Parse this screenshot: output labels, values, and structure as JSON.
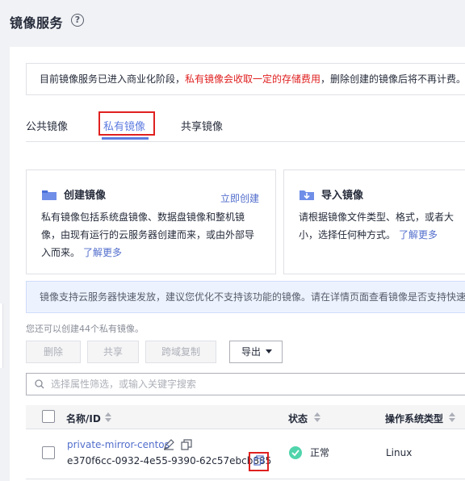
{
  "page": {
    "title": "镜像服务",
    "help_icon": "?"
  },
  "notice": {
    "text_before": "目前镜像服务已进入商业化阶段，",
    "text_red": "私有镜像会收取一定的存储费用",
    "text_after": "，删除创建的镜像后将不再计费。"
  },
  "tabs": [
    {
      "label": "公共镜像"
    },
    {
      "label": "私有镜像",
      "active": true
    },
    {
      "label": "共享镜像"
    }
  ],
  "cards": {
    "create": {
      "title": "创建镜像",
      "action": "立即创建",
      "desc": "私有镜像包括系统盘镜像、数据盘镜像和整机镜像，由现有运行的云服务器创建而来，或由外部导入而来。",
      "learn_more": "了解更多"
    },
    "import": {
      "title": "导入镜像",
      "desc": "请根据镜像文件类型、格式，或者大小，选择任何种方式。",
      "learn_more": "了解更多"
    }
  },
  "info_bar": "镜像支持云服务器快速发放，建议您优化不支持该功能的镜像。请在详情页面查看镜像是否支持快速",
  "quota": "您还可以创建44个私有镜像。",
  "toolbar": {
    "delete": "删除",
    "share": "共享",
    "cross_region": "跨域复制",
    "export": "导出"
  },
  "search": {
    "placeholder": "选择属性筛选，或输入关键字搜索"
  },
  "table": {
    "headers": {
      "name": "名称/ID",
      "status": "状态",
      "os": "操作系统类型"
    },
    "rows": [
      {
        "name": "private-mirror-centos",
        "id": "e370f6cc-0932-4e55-9390-62c57ebcb885",
        "status": "正常",
        "os": "Linux"
      }
    ]
  },
  "colors": {
    "accent": "#5e7ce0",
    "link": "#526ecc",
    "highlight": "#e02020",
    "success": "#50d4ab"
  }
}
